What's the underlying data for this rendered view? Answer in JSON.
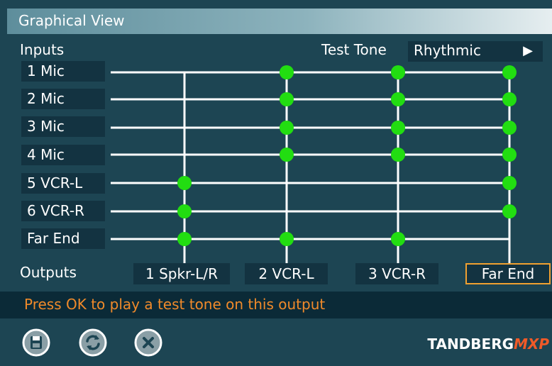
{
  "title": "Graphical View",
  "inputs_heading": "Inputs",
  "outputs_heading": "Outputs",
  "test_tone": {
    "label": "Test Tone",
    "value": "Rhythmic"
  },
  "inputs": [
    "1 Mic",
    "2 Mic",
    "3 Mic",
    "4 Mic",
    "5 VCR-L",
    "6 VCR-R",
    "Far End"
  ],
  "outputs": [
    "1 Spkr-L/R",
    "2 VCR-L",
    "3 VCR-R",
    "Far End"
  ],
  "selected_output": "Far End",
  "connections": [
    {
      "input": "1 Mic",
      "outputs": [
        "2 VCR-L",
        "3 VCR-R",
        "Far End"
      ]
    },
    {
      "input": "2 Mic",
      "outputs": [
        "2 VCR-L",
        "3 VCR-R",
        "Far End"
      ]
    },
    {
      "input": "3 Mic",
      "outputs": [
        "2 VCR-L",
        "3 VCR-R",
        "Far End"
      ]
    },
    {
      "input": "4 Mic",
      "outputs": [
        "2 VCR-L",
        "3 VCR-R",
        "Far End"
      ]
    },
    {
      "input": "5 VCR-L",
      "outputs": [
        "1 Spkr-L/R",
        "Far End"
      ]
    },
    {
      "input": "6 VCR-R",
      "outputs": [
        "1 Spkr-L/R",
        "Far End"
      ]
    },
    {
      "input": "Far End",
      "outputs": [
        "1 Spkr-L/R",
        "2 VCR-L",
        "3 VCR-R"
      ]
    }
  ],
  "status_message": "Press OK to play a test tone on this output",
  "toolbar": {
    "save_icon": "save-icon",
    "refresh_icon": "refresh-icon",
    "close_icon": "close-icon"
  },
  "brand": {
    "name": "TANDBERG",
    "suffix": "MXP"
  },
  "colors": {
    "connection_dot": "#22dd11",
    "status_text": "#f08a2a",
    "selected_border": "#f0a030",
    "background": "#1d4553"
  }
}
